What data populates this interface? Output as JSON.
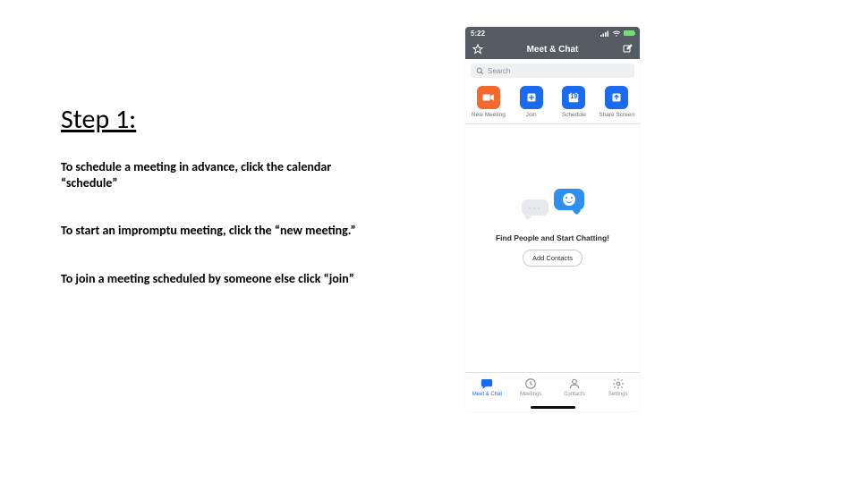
{
  "doc": {
    "step_title": "Step 1:",
    "instructions": [
      "To schedule a meeting in advance, click the calendar “schedule”",
      "To start an impromptu meeting, click the “new meeting.”",
      "To join a meeting scheduled by someone else click “join”"
    ]
  },
  "phone": {
    "status": {
      "time": "5:22"
    },
    "header": {
      "title": "Meet & Chat"
    },
    "search": {
      "placeholder": "Search"
    },
    "actions": [
      {
        "label": "New Meeting",
        "color": "orange",
        "icon": "video"
      },
      {
        "label": "Join",
        "color": "blue",
        "icon": "plus"
      },
      {
        "label": "Schedule",
        "color": "blue",
        "icon": "calendar",
        "badge": "19"
      },
      {
        "label": "Share Screen",
        "color": "blue",
        "icon": "share"
      }
    ],
    "empty": {
      "title": "Find People and Start Chatting!",
      "button": "Add Contacts"
    },
    "tabs": [
      {
        "label": "Meet & Chat",
        "icon": "chat",
        "active": true
      },
      {
        "label": "Meetings",
        "icon": "clock",
        "active": false
      },
      {
        "label": "Contacts",
        "icon": "contacts",
        "active": false
      },
      {
        "label": "Settings",
        "icon": "gear",
        "active": false
      }
    ]
  }
}
